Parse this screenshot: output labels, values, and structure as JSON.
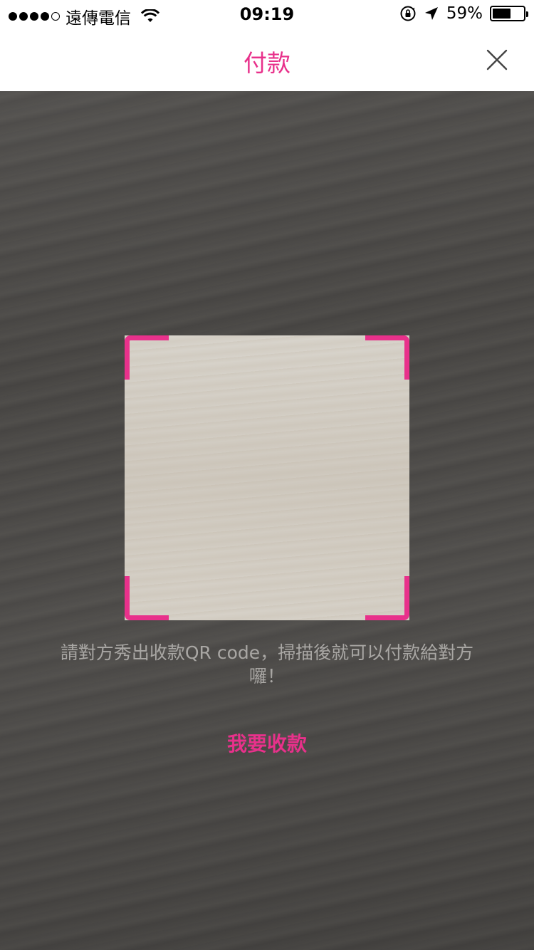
{
  "status_bar": {
    "signal_filled": 4,
    "signal_total": 5,
    "carrier": "遠傳電信",
    "time": "09:19",
    "battery_percent_text": "59%",
    "battery_level": 0.59,
    "icons": [
      "wifi-icon",
      "orientation-lock-icon",
      "location-icon",
      "battery-icon"
    ]
  },
  "nav": {
    "title": "付款",
    "close_icon": "close-icon"
  },
  "scanner": {
    "instruction": "請對方秀出收款QR code，掃描後就可以付款給對方囉！",
    "receive_button": "我要收款"
  },
  "colors": {
    "accent": "#e8318b",
    "instruction_text": "#a9a7a4",
    "camera_bg": "#4a4846"
  }
}
